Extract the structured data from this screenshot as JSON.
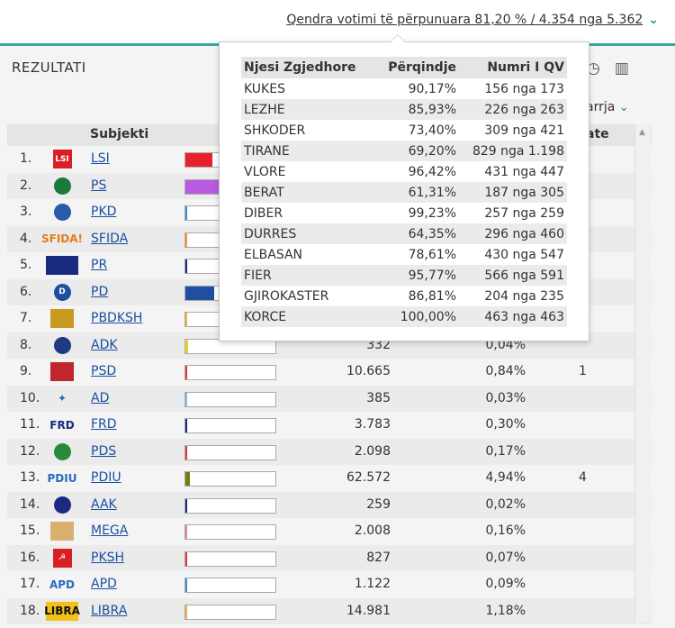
{
  "top_link": {
    "text": "Qendra votimi të përpunuara 81,20 % / 4.354 nga 5.362",
    "chevron": "chevron-down-icon"
  },
  "header": {
    "title": "REZULTATI",
    "sort_label": "arrja"
  },
  "table": {
    "col_subjekti": "Subjekti",
    "col_mandate": "ate",
    "rows": [
      {
        "num": "1.",
        "name": "LSI",
        "votes": "",
        "pct": "",
        "mand": "",
        "bar_color": "#e8202a",
        "bar_pct": 0.3,
        "logo_bg": "#d81f26",
        "logo_text": "LSI",
        "logo_type": "red"
      },
      {
        "num": "2.",
        "name": "PS",
        "votes": "",
        "pct": "",
        "mand": "",
        "bar_color": "#b75ce0",
        "bar_pct": 0.65,
        "logo_bg": "#1a7a3a",
        "logo_text": "",
        "logo_type": "circle"
      },
      {
        "num": "3.",
        "name": "PKD",
        "votes": "",
        "pct": "",
        "mand": "",
        "bar_color": "#3b8fd6",
        "bar_pct": 0.02,
        "logo_bg": "#2a5ba8",
        "logo_text": "",
        "logo_type": "circle"
      },
      {
        "num": "4.",
        "name": "SFIDA",
        "votes": "",
        "pct": "",
        "mand": "",
        "bar_color": "#f29a3a",
        "bar_pct": 0.02,
        "logo_bg": "#ffffff",
        "logo_text": "SFIDA!",
        "logo_type": "text",
        "logo_color": "#e87a1a"
      },
      {
        "num": "5.",
        "name": "PR",
        "votes": "",
        "pct": "",
        "mand": "",
        "bar_color": "#1a2a80",
        "bar_pct": 0.02,
        "logo_bg": "#1a2a80",
        "logo_text": "",
        "logo_type": "rect"
      },
      {
        "num": "6.",
        "name": "PD",
        "votes": "",
        "pct": "",
        "mand": "",
        "bar_color": "#1e4fa0",
        "bar_pct": 0.32,
        "logo_bg": "#1e4fa0",
        "logo_text": "D",
        "logo_type": "circle"
      },
      {
        "num": "7.",
        "name": "PBDKSH",
        "votes": "",
        "pct": "",
        "mand": "",
        "bar_color": "#f2b03a",
        "bar_pct": 0.02,
        "logo_bg": "#c89a20",
        "logo_text": "",
        "logo_type": "rect-small"
      },
      {
        "num": "8.",
        "name": "ADK",
        "votes": "",
        "pct": "",
        "mand": "",
        "bar_color": "#e6d22a",
        "bar_pct": 0.03,
        "logo_bg": "#1e3a80",
        "logo_text": "",
        "logo_type": "circle"
      },
      {
        "num": "9.",
        "name": "PSD",
        "votes": "10.665",
        "pct": "0,84%",
        "mand": "1",
        "bar_color": "#d83a3a",
        "bar_pct": 0.02,
        "logo_bg": "#c0262a",
        "logo_text": "",
        "logo_type": "rect-small"
      },
      {
        "num": "10.",
        "name": "AD",
        "votes": "385",
        "pct": "0,03%",
        "mand": "",
        "bar_color": "#7fb8e0",
        "bar_pct": 0.02,
        "logo_bg": "#ffffff",
        "logo_text": "✦",
        "logo_type": "text",
        "logo_color": "#2a6ac0"
      },
      {
        "num": "11.",
        "name": "FRD",
        "votes": "3.783",
        "pct": "0,30%",
        "mand": "",
        "bar_color": "#1a2a80",
        "bar_pct": 0.02,
        "logo_bg": "#ffffff",
        "logo_text": "FRD",
        "logo_type": "text",
        "logo_color": "#1a2a80"
      },
      {
        "num": "12.",
        "name": "PDS",
        "votes": "2.098",
        "pct": "0,17%",
        "mand": "",
        "bar_color": "#d83a3a",
        "bar_pct": 0.02,
        "logo_bg": "#2a8a3a",
        "logo_text": "",
        "logo_type": "circle"
      },
      {
        "num": "13.",
        "name": "PDIU",
        "votes": "62.572",
        "pct": "4,94%",
        "mand": "4",
        "bar_color": "#7a7a10",
        "bar_pct": 0.05,
        "logo_bg": "#ffffff",
        "logo_text": "PDIU",
        "logo_type": "text",
        "logo_color": "#2a6ac0"
      },
      {
        "num": "14.",
        "name": "AAK",
        "votes": "259",
        "pct": "0,02%",
        "mand": "",
        "bar_color": "#1a2a80",
        "bar_pct": 0.02,
        "logo_bg": "#1a2a80",
        "logo_text": "",
        "logo_type": "circle"
      },
      {
        "num": "15.",
        "name": "MEGA",
        "votes": "2.008",
        "pct": "0,16%",
        "mand": "",
        "bar_color": "#e08a8a",
        "bar_pct": 0.02,
        "logo_bg": "#d8b070",
        "logo_text": "",
        "logo_type": "rect-small"
      },
      {
        "num": "16.",
        "name": "PKSH",
        "votes": "827",
        "pct": "0,07%",
        "mand": "",
        "bar_color": "#d83a3a",
        "bar_pct": 0.02,
        "logo_bg": "#d81f26",
        "logo_text": "☭",
        "logo_type": "red"
      },
      {
        "num": "17.",
        "name": "APD",
        "votes": "1.122",
        "pct": "0,09%",
        "mand": "",
        "bar_color": "#3b8fd6",
        "bar_pct": 0.02,
        "logo_bg": "#ffffff",
        "logo_text": "APD",
        "logo_type": "text",
        "logo_color": "#2a6ac0"
      },
      {
        "num": "18.",
        "name": "LIBRA",
        "votes": "14.981",
        "pct": "1,18%",
        "mand": "",
        "bar_color": "#f2b03a",
        "bar_pct": 0.02,
        "logo_bg": "#f2c21a",
        "logo_text": "LIBRA",
        "logo_type": "text-bg",
        "logo_color": "#111"
      }
    ]
  },
  "popup": {
    "headers": [
      "Njesi Zgjedhore",
      "Përqindje",
      "Numri I QV"
    ],
    "rows": [
      [
        "KUKES",
        "90,17%",
        "156 nga 173"
      ],
      [
        "LEZHE",
        "85,93%",
        "226 nga 263"
      ],
      [
        "SHKODER",
        "73,40%",
        "309 nga 421"
      ],
      [
        "TIRANE",
        "69,20%",
        "829 nga 1.198"
      ],
      [
        "VLORE",
        "96,42%",
        "431 nga 447"
      ],
      [
        "BERAT",
        "61,31%",
        "187 nga 305"
      ],
      [
        "DIBER",
        "99,23%",
        "257 nga 259"
      ],
      [
        "DURRES",
        "64,35%",
        "296 nga 460"
      ],
      [
        "ELBASAN",
        "78,61%",
        "430 nga 547"
      ],
      [
        "FIER",
        "95,77%",
        "566 nga 591"
      ],
      [
        "GJIROKASTER",
        "86,81%",
        "204 nga 235"
      ],
      [
        "KORCE",
        "100,00%",
        "463 nga 463"
      ]
    ]
  },
  "partial_under_popup": {
    "row8_votes": "332",
    "row8_pct": "0,04%"
  }
}
